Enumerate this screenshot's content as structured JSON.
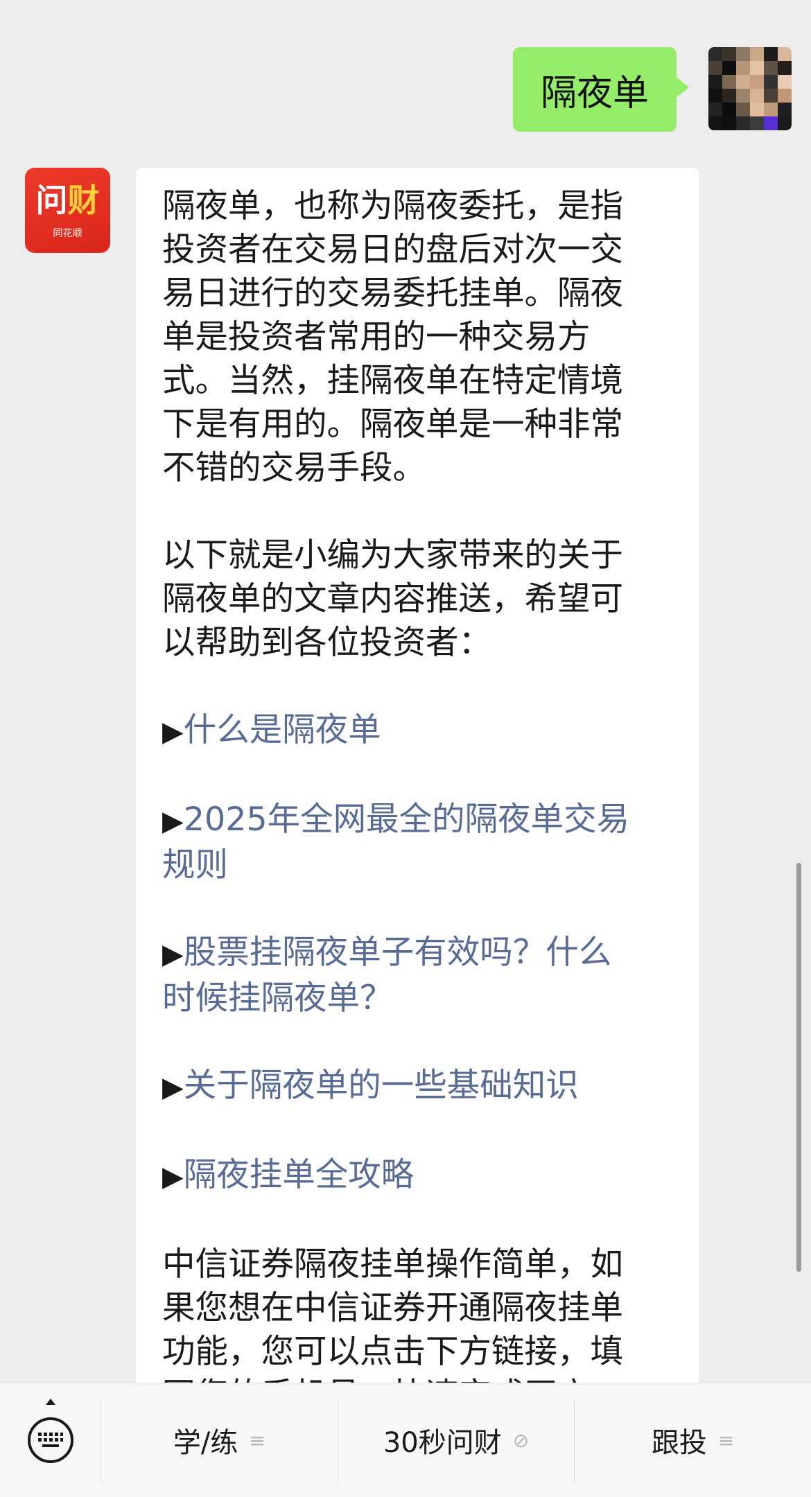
{
  "user_message": {
    "text": "隔夜单"
  },
  "bot": {
    "avatar_logo": "问财",
    "avatar_subtitle": "同花顺",
    "paragraph1_lines": [
      "隔夜单，也称为隔夜委托，是指",
      "投资者在交易日的盘后对次一交",
      "易日进行的交易委托挂单。隔夜",
      "单是投资者常用的一种交易方",
      "式。当然，挂隔夜单在特定情境",
      "下是有用的。隔夜单是一种非常",
      "不错的交易手段。"
    ],
    "paragraph2_lines": [
      "以下就是小编为大家带来的关于",
      "隔夜单的文章内容推送，希望可",
      "以帮助到各位投资者："
    ],
    "link_marker": "▶",
    "links": [
      {
        "lines": [
          "什么是隔夜单"
        ]
      },
      {
        "lines": [
          "2025年全网最全的隔夜单交易",
          "规则"
        ]
      },
      {
        "lines": [
          "股票挂隔夜单子有效吗？什么",
          "时候挂隔夜单？"
        ]
      },
      {
        "lines": [
          "关于隔夜单的一些基础知识"
        ]
      },
      {
        "lines": [
          "隔夜挂单全攻略"
        ]
      }
    ],
    "paragraph3_lines": [
      "中信证券隔夜挂单操作简单，如",
      "果您想在中信证券开通隔夜挂单",
      "功能，您可以点击下方链接，填",
      "写您的手机号，快速完成开户"
    ],
    "link_color": "#576b95"
  },
  "bottom_menu": {
    "keyboard_icon": "keyboard-icon",
    "items": [
      {
        "label": "学/练",
        "icon": "≡"
      },
      {
        "label": "30秒问财",
        "icon": "⊘"
      },
      {
        "label": "跟投",
        "icon": "≡"
      }
    ]
  },
  "colors": {
    "background": "#ededed",
    "user_bubble": "#95ec69",
    "bot_bubble": "#ffffff",
    "avatar_red": "#e2301f"
  }
}
